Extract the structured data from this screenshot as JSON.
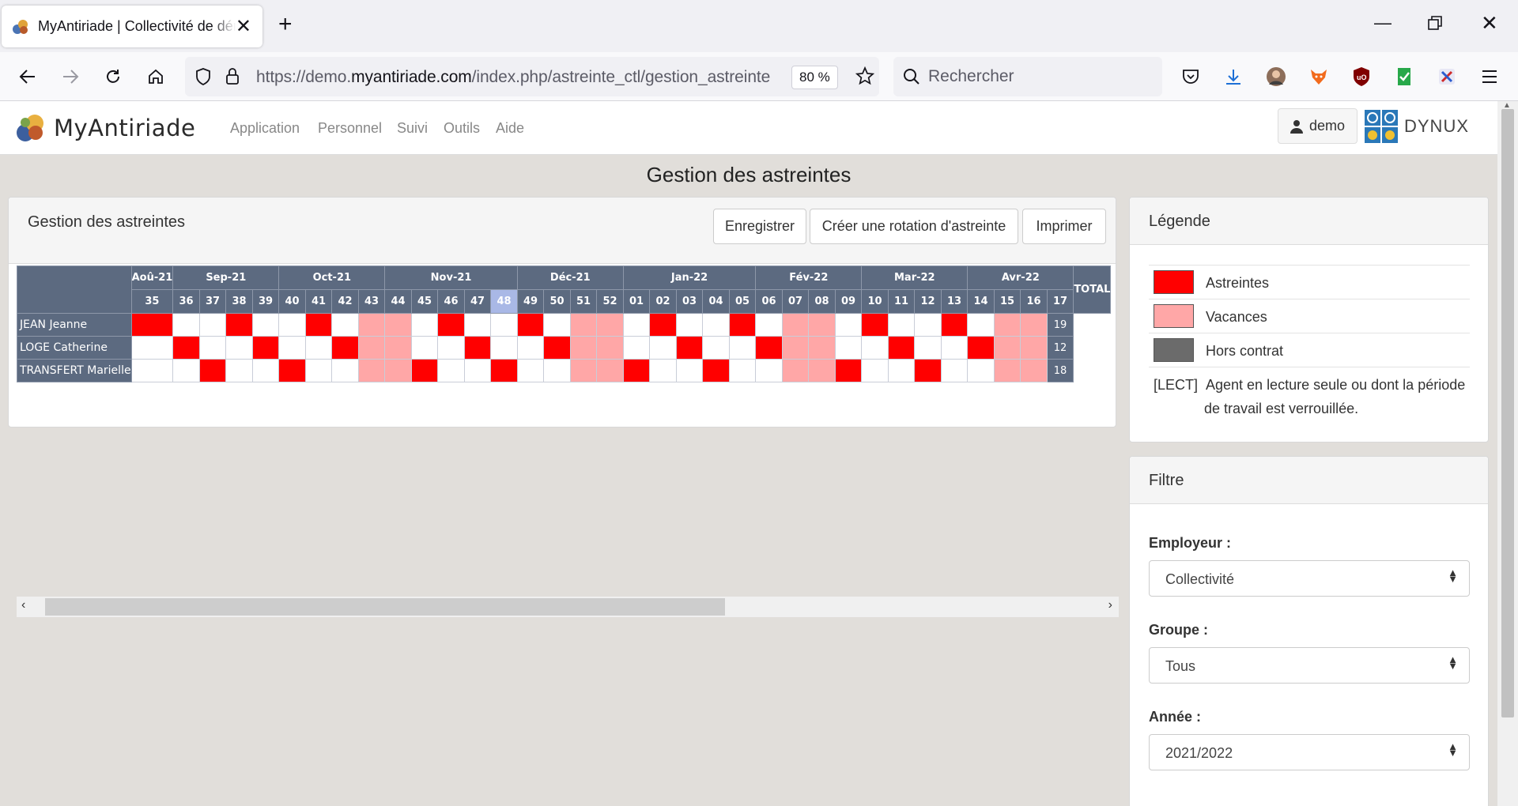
{
  "browser": {
    "tab_title": "MyAntiriade | Collectivité de dém",
    "url_prefix": "https://demo.",
    "url_domain": "myantiriade.com",
    "url_path": "/index.php/astreinte_ctl/gestion_astreinte",
    "zoom": "80 %",
    "search_placeholder": "Rechercher"
  },
  "app": {
    "logo_text": "MyAntiriade",
    "menu": [
      "Application",
      "Personnel",
      "Suivi",
      "Outils",
      "Aide"
    ],
    "user": "demo",
    "partner_logo": "DYNUX"
  },
  "page_title": "Gestion des astreintes",
  "panel": {
    "title": "Gestion des astreintes",
    "buttons": {
      "save": "Enregistrer",
      "rotation": "Créer une rotation d'astreinte",
      "print": "Imprimer"
    },
    "total_label": "TOTAL",
    "months": [
      {
        "label": "Aoû-21",
        "weeks": [
          "35"
        ]
      },
      {
        "label": "Sep-21",
        "weeks": [
          "36",
          "37",
          "38",
          "39"
        ]
      },
      {
        "label": "Oct-21",
        "weeks": [
          "40",
          "41",
          "42",
          "43"
        ]
      },
      {
        "label": "Nov-21",
        "weeks": [
          "44",
          "45",
          "46",
          "47",
          "48"
        ]
      },
      {
        "label": "Déc-21",
        "weeks": [
          "49",
          "50",
          "51",
          "52"
        ]
      },
      {
        "label": "Jan-22",
        "weeks": [
          "01",
          "02",
          "03",
          "04",
          "05"
        ]
      },
      {
        "label": "Fév-22",
        "weeks": [
          "06",
          "07",
          "08",
          "09"
        ]
      },
      {
        "label": "Mar-22",
        "weeks": [
          "10",
          "11",
          "12",
          "13"
        ]
      },
      {
        "label": "Avr-22",
        "weeks": [
          "14",
          "15",
          "16",
          "17"
        ]
      }
    ],
    "current_week": "48",
    "agents": [
      {
        "name": "JEAN Jeanne",
        "total": "19",
        "cells": [
          "A",
          "",
          "",
          "A",
          "",
          "",
          "A",
          "",
          "V",
          "V",
          "",
          "A",
          "",
          "",
          "A",
          "",
          "V",
          "V",
          "",
          "A",
          "",
          "",
          "A",
          "",
          "V",
          "V",
          "",
          "A",
          "",
          "",
          "A",
          "",
          "V",
          "V"
        ]
      },
      {
        "name": "LOGE Catherine",
        "total": "12",
        "cells": [
          "",
          "A",
          "",
          "",
          "A",
          "",
          "",
          "A",
          "V",
          "V",
          "",
          "",
          "A",
          "",
          "",
          "A",
          "V",
          "V",
          "",
          "",
          "A",
          "",
          "",
          "A",
          "V",
          "V",
          "",
          "",
          "A",
          "",
          "",
          "A",
          "V",
          "V"
        ]
      },
      {
        "name": "TRANSFERT Marielle",
        "total": "18",
        "cells": [
          "",
          "",
          "A",
          "",
          "",
          "A",
          "",
          "",
          "V",
          "V",
          "A",
          "",
          "",
          "A",
          "",
          "",
          "V",
          "V",
          "A",
          "",
          "",
          "A",
          "",
          "",
          "V",
          "V",
          "A",
          "",
          "",
          "A",
          "",
          "",
          "V",
          "V"
        ]
      }
    ]
  },
  "legend": {
    "title": "Légende",
    "items": [
      {
        "label": "Astreintes",
        "color": "#ff0000"
      },
      {
        "label": "Vacances",
        "color": "#ffa7a7"
      },
      {
        "label": "Hors contrat",
        "color": "#6b6b6b"
      }
    ],
    "lect_tag": "[LECT]",
    "lect_text_1": "Agent en lecture seule ou dont la période",
    "lect_text_2": "de travail est verrouillée."
  },
  "filter": {
    "title": "Filtre",
    "employer_label": "Employeur :",
    "employer_value": "Collectivité",
    "group_label": "Groupe :",
    "group_value": "Tous",
    "year_label": "Année :",
    "year_value": "2021/2022"
  }
}
